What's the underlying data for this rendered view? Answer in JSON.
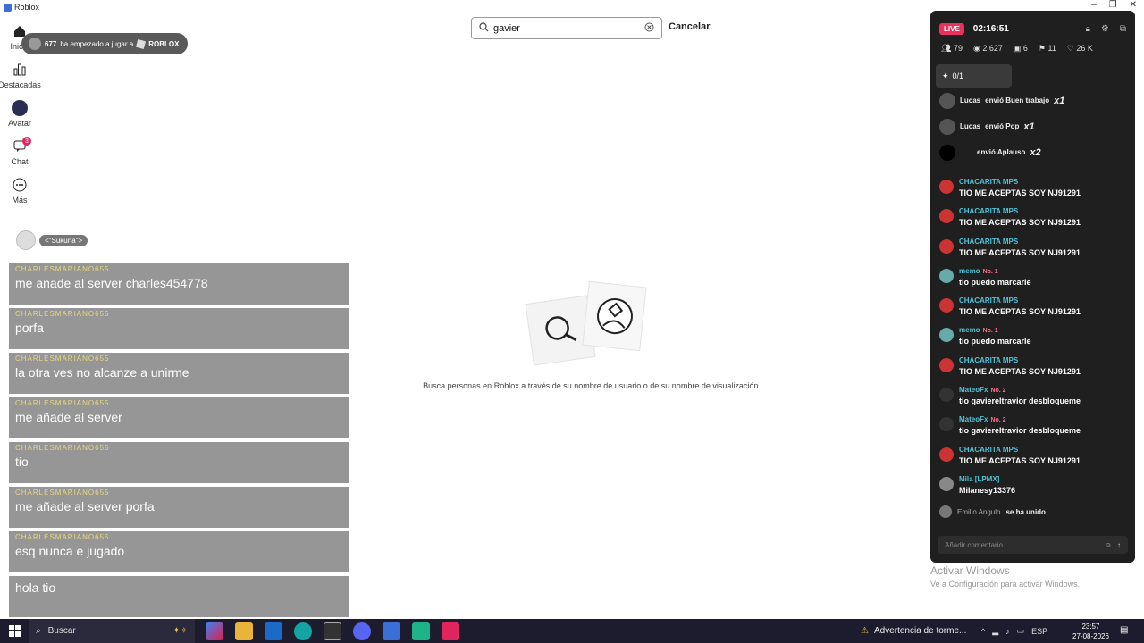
{
  "window": {
    "title": "Roblox"
  },
  "sidebar": {
    "items": [
      {
        "label": "Inicio",
        "icon": "home-icon"
      },
      {
        "label": "Destacadas",
        "icon": "chart-icon"
      },
      {
        "label": "Avatar",
        "icon": "avatar-icon"
      },
      {
        "label": "Chat",
        "icon": "chat-icon",
        "badge": "3"
      },
      {
        "label": "Más",
        "icon": "more-icon"
      }
    ]
  },
  "toast": {
    "count": "677",
    "text": "ha empezado a jugar a",
    "brand": "ROBLOX"
  },
  "search": {
    "value": "gavier",
    "cancel_label": "Cancelar"
  },
  "empty_state": {
    "text": "Busca personas en Roblox a través de su nombre de usuario o de su nombre de visualización."
  },
  "overlay": {
    "sukuna_tag": "<\"Sukuna\">",
    "messages": [
      {
        "user": "CHARLESMARIANO655",
        "text": "me anade al server charles454778"
      },
      {
        "user": "CHARLESMARIANO655",
        "text": "porfa"
      },
      {
        "user": "CHARLESMARIANO655",
        "text": "la otra ves no alcanze a unirme"
      },
      {
        "user": "CHARLESMARIANO655",
        "text": "me añade al server"
      },
      {
        "user": "CHARLESMARIANO655",
        "text": "tio"
      },
      {
        "user": "CHARLESMARIANO655",
        "text": "me añade al server porfa"
      },
      {
        "user": "CHARLESMARIANO655",
        "text": "esq nunca e jugado"
      },
      {
        "user": "",
        "text": "hola tio"
      }
    ]
  },
  "live": {
    "badge": "LIVE",
    "timer": "02:16:51",
    "stats": [
      "79",
      "2.627",
      "6",
      "11",
      "26 K"
    ],
    "gift_goal": "0/1",
    "gifts": [
      {
        "user": "Lucas",
        "text": "envió Buen trabajo",
        "mult": "x1"
      },
      {
        "user": "Lucas",
        "text": "envió Pop",
        "mult": "x1"
      },
      {
        "user": "",
        "text": "envió Aplauso",
        "mult": "x2"
      }
    ],
    "comments": [
      {
        "name": "CHACARITA MPS",
        "rank": "",
        "text": "TIO ME ACEPTAS SOY NJ91291"
      },
      {
        "name": "CHACARITA MPS",
        "rank": "",
        "text": "TIO ME ACEPTAS SOY NJ91291"
      },
      {
        "name": "CHACARITA MPS",
        "rank": "",
        "text": "TIO ME ACEPTAS SOY NJ91291"
      },
      {
        "name": "memo",
        "rank": "No. 1",
        "text": "tio puedo marcarle"
      },
      {
        "name": "CHACARITA MPS",
        "rank": "",
        "text": "TIO ME ACEPTAS SOY NJ91291"
      },
      {
        "name": "memo",
        "rank": "No. 1",
        "text": "tio puedo marcarle"
      },
      {
        "name": "CHACARITA MPS",
        "rank": "",
        "text": "TIO ME ACEPTAS SOY NJ91291"
      },
      {
        "name": "MateoFx",
        "rank": "No. 2",
        "text": "tio gaviereltravior desbloqueme"
      },
      {
        "name": "MateoFx",
        "rank": "No. 2",
        "text": "tio gaviereltravior desbloqueme"
      },
      {
        "name": "CHACARITA MPS",
        "rank": "",
        "text": "TIO ME ACEPTAS SOY NJ91291"
      },
      {
        "name": "Mila [LPMX]",
        "rank": "",
        "text": "Milanesy13376"
      }
    ],
    "joined": {
      "name": "Emilio Angulo",
      "text": "se ha unido"
    },
    "comment_placeholder": "Añadir comentario"
  },
  "activate": {
    "title": "Activar Windows",
    "sub": "Ve a Configuración para activar Windows."
  },
  "taskbar": {
    "search": "Buscar",
    "warning": "Advertencia de torme...",
    "lang": "ESP",
    "time": "23:57",
    "date": "27-08-2026"
  }
}
